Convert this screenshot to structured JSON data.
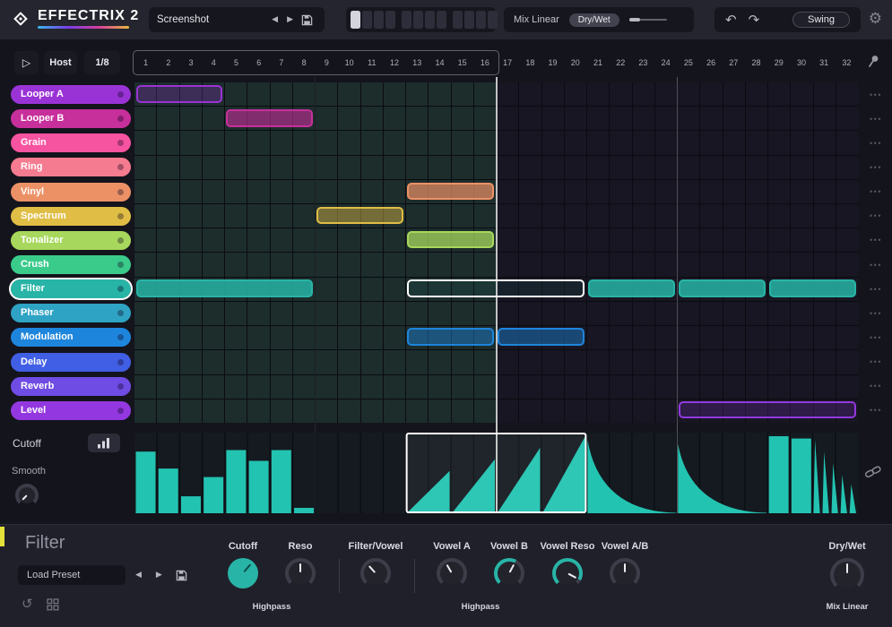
{
  "app": {
    "title": "EFFECTRIX 2"
  },
  "topbar": {
    "preset": {
      "value": "Screenshot"
    },
    "pattern": {
      "slots": 12,
      "active": 1
    },
    "mix": {
      "mode_label": "Mix Linear",
      "drywet_label": "Dry/Wet"
    },
    "swing_label": "Swing"
  },
  "transport": {
    "host_label": "Host",
    "rate_label": "1/8"
  },
  "sequencer": {
    "step_count": 32,
    "loop_steps": 16,
    "step_numbers": [
      "1",
      "2",
      "3",
      "4",
      "5",
      "6",
      "7",
      "8",
      "9",
      "10",
      "11",
      "12",
      "13",
      "14",
      "15",
      "16",
      "17",
      "18",
      "19",
      "20",
      "21",
      "22",
      "23",
      "24",
      "25",
      "26",
      "27",
      "28",
      "29",
      "30",
      "31",
      "32"
    ],
    "tracks": [
      {
        "name": "Looper A",
        "color": "#9a33d6"
      },
      {
        "name": "Looper B",
        "color": "#c72f9b"
      },
      {
        "name": "Grain",
        "color": "#f653a0"
      },
      {
        "name": "Ring",
        "color": "#f47b90"
      },
      {
        "name": "Vinyl",
        "color": "#ec9166"
      },
      {
        "name": "Spectrum",
        "color": "#e0bd45"
      },
      {
        "name": "Tonalizer",
        "color": "#a7d75c"
      },
      {
        "name": "Crush",
        "color": "#3acb8b"
      },
      {
        "name": "Filter",
        "color": "#28b4a6",
        "selected": true
      },
      {
        "name": "Phaser",
        "color": "#2fa3c4"
      },
      {
        "name": "Modulation",
        "color": "#1e85dc"
      },
      {
        "name": "Delay",
        "color": "#415fe4"
      },
      {
        "name": "Reverb",
        "color": "#6f4ce4"
      },
      {
        "name": "Level",
        "color": "#9338e0"
      }
    ],
    "blocks": [
      {
        "track": 0,
        "start": 1,
        "len": 4,
        "fill": 0.25
      },
      {
        "track": 1,
        "start": 5,
        "len": 4,
        "fill": 0.6
      },
      {
        "track": 4,
        "start": 13,
        "len": 4,
        "fill": 0.7
      },
      {
        "track": 5,
        "start": 9,
        "len": 4,
        "fill": 0.45
      },
      {
        "track": 6,
        "start": 13,
        "len": 4,
        "fill": 0.75
      },
      {
        "track": 8,
        "start": 1,
        "len": 8,
        "fill": 0.85
      },
      {
        "track": 8,
        "start": 13,
        "len": 8,
        "fill": 0.08,
        "selected": true
      },
      {
        "track": 8,
        "start": 21,
        "len": 4,
        "fill": 0.85
      },
      {
        "track": 8,
        "start": 25,
        "len": 4,
        "fill": 0.85
      },
      {
        "track": 8,
        "start": 29,
        "len": 4,
        "fill": 0.85
      },
      {
        "track": 10,
        "start": 13,
        "len": 4,
        "fill": 0.45
      },
      {
        "track": 10,
        "start": 17,
        "len": 4,
        "fill": 0.45
      },
      {
        "track": 13,
        "start": 25,
        "len": 8,
        "fill": 0.2
      }
    ]
  },
  "automation": {
    "param_label": "Cutoff",
    "smooth_label": "Smooth",
    "smooth_angle": -135,
    "wave_color": "#23c3b1",
    "selection": {
      "start": 13,
      "len": 8
    },
    "segments": [
      {
        "type": "bars",
        "start": 1,
        "heights": [
          0.8,
          0.58,
          0.22,
          0.47,
          0.82,
          0.68,
          0.82,
          0.07
        ]
      },
      {
        "type": "ramps",
        "start": 13,
        "ramp_steps": 2,
        "peaks": [
          0.55,
          0.7,
          0.85,
          1.0
        ]
      },
      {
        "type": "decay",
        "start": 21,
        "len": 4,
        "peak": 0.95
      },
      {
        "type": "decay",
        "start": 25,
        "len": 4,
        "peak": 0.9
      },
      {
        "type": "bars",
        "start": 29,
        "heights": [
          1.0,
          0.97
        ]
      },
      {
        "type": "spikes",
        "start": 31,
        "len": 2,
        "peaks": [
          0.95,
          0.8,
          0.65,
          0.5,
          0.38
        ]
      }
    ]
  },
  "effect_panel": {
    "title": "Filter",
    "preset_label": "Load Preset",
    "knobs": [
      {
        "label": "Cutoff",
        "style": "filled",
        "angle": 40
      },
      {
        "label": "Reso",
        "style": "plain",
        "angle": 0
      },
      {
        "label": "Filter/Vowel",
        "style": "plain",
        "angle": -42
      },
      {
        "label": "Vowel A",
        "style": "plain",
        "angle": -30
      },
      {
        "label": "Vowel B",
        "style": "arc",
        "angle": 28
      },
      {
        "label": "Vowel Reso",
        "style": "arc",
        "angle": 118
      },
      {
        "label": "Vowel A/B",
        "style": "plain",
        "angle": 0
      }
    ],
    "sub_labels": [
      {
        "text": "Highpass"
      },
      {
        "text": "Highpass"
      }
    ],
    "drywet": {
      "label": "Dry/Wet",
      "style": "plain",
      "angle": 0,
      "sub_label": "Mix Linear"
    }
  },
  "colors": {
    "accent_teal": "#28b4a6",
    "accent_yellow": "#e4e23a"
  }
}
